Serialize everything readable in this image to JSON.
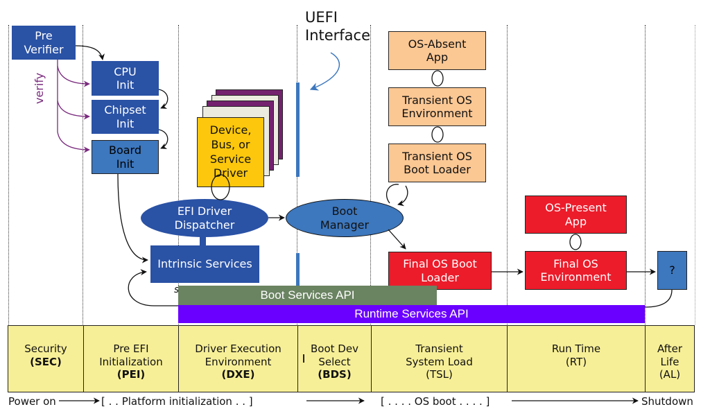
{
  "title": {
    "uefi_line1": "UEFI",
    "uefi_line2": "Interface"
  },
  "blocks": {
    "pre_verifier": "Pre\nVerifier",
    "verify_label": "verify",
    "cpu_init": "CPU\nInit",
    "chipset_init": "Chipset\nInit",
    "board_init": "Board\nInit",
    "driver": "Device,\nBus, or\nService\nDriver",
    "efi_dispatcher": "EFI Driver\nDispatcher",
    "intrinsic_services": "Intrinsic Services",
    "boot_manager": "Boot\nManager",
    "os_absent_app": "OS-Absent\nApp",
    "transient_os_env": "Transient OS\nEnvironment",
    "transient_os_loader": "Transient OS\nBoot Loader",
    "final_os_loader": "Final OS Boot\nLoader",
    "os_present_app": "OS-Present\nApp",
    "final_os_env": "Final OS\nEnvironment",
    "after_life_box": "?",
    "small_s_label": "s"
  },
  "apis": {
    "boot_services": "Boot Services API",
    "runtime_services": "Runtime Services API"
  },
  "phases": [
    {
      "name": "Security",
      "abbr": "(SEC)",
      "bold": true
    },
    {
      "name": "Pre EFI\nInitialization",
      "abbr": "(PEI)",
      "bold": true
    },
    {
      "name": "Driver Execution\nEnvironment",
      "abbr": "(DXE)",
      "bold": true
    },
    {
      "name": "Boot Dev\nSelect",
      "abbr": "(BDS)",
      "bold": true
    },
    {
      "name": "Transient\nSystem Load",
      "abbr": "(TSL)",
      "bold": false
    },
    {
      "name": "Run Time",
      "abbr": "(RT)",
      "bold": false
    },
    {
      "name": "After\nLife",
      "abbr": "(AL)",
      "bold": false
    }
  ],
  "timeline": {
    "start": "Power on",
    "platform_init": "[ . . Platform initialization . . ]",
    "os_boot": "[ . . . . OS boot . . . . ]",
    "end": "Shutdown"
  },
  "colors": {
    "sec_pei_blue": "#2a52a5",
    "board_blue": "#3d77bd",
    "driver_yellow": "#fcc70c",
    "stack_purple": "#74226f",
    "stack_cream": "#ecebe0",
    "transient_orange": "#fbc793",
    "final_red": "#ec1c2b",
    "boot_services_green": "#6a8361",
    "runtime_services_purple": "#6a00ff",
    "phase_yellow": "#f7ef97",
    "verify_purple": "#7a2a7e",
    "uefi_bar_blue": "#3d77bd"
  }
}
